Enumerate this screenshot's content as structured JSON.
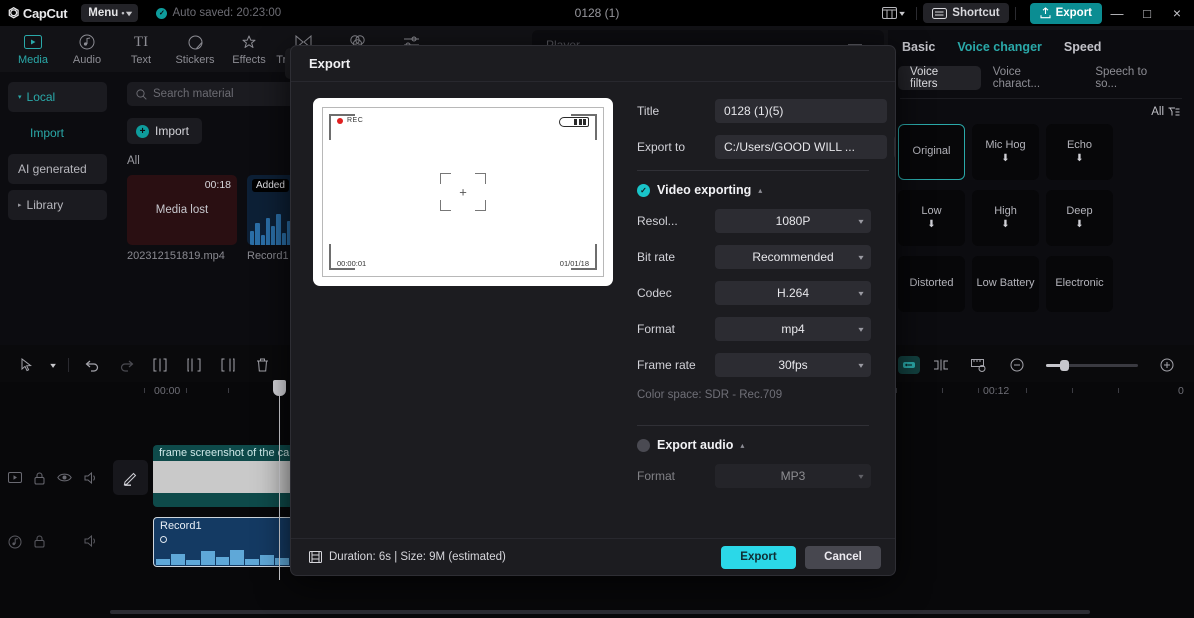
{
  "titlebar": {
    "logo": "CapCut",
    "menu_label": "Menu",
    "autosaved": "Auto saved: 20:23:00",
    "project_title": "0128 (1)",
    "shortcut_label": "Shortcut",
    "export_label": "Export",
    "minimize": "—",
    "maximize": "□",
    "close": "×"
  },
  "tabs": [
    {
      "label": "Media",
      "icon": "media-icon",
      "active": true
    },
    {
      "label": "Audio",
      "icon": "audio-icon",
      "active": false
    },
    {
      "label": "Text",
      "icon": "text-icon",
      "active": false
    },
    {
      "label": "Stickers",
      "icon": "stickers-icon",
      "active": false
    },
    {
      "label": "Effects",
      "icon": "effects-icon",
      "active": false
    },
    {
      "label": "Transitions",
      "icon": "transitions-icon",
      "active": false
    },
    {
      "label": "Filters",
      "icon": "filters-icon",
      "active": false
    },
    {
      "label": "Adjustment",
      "icon": "adjustment-icon",
      "active": false
    }
  ],
  "leftnav": [
    {
      "label": "Local",
      "selected": true
    },
    {
      "label": "Import",
      "selected": false
    },
    {
      "label": "AI generated",
      "selected": false
    },
    {
      "label": "Library",
      "selected": false
    }
  ],
  "media": {
    "search_placeholder": "Search material",
    "import_label": "Import",
    "all_label": "All",
    "items": [
      {
        "name": "202312151819.mp4",
        "duration": "00:18",
        "state": "Media lost",
        "badge": ""
      },
      {
        "name": "Record1",
        "duration": "",
        "state": "",
        "badge": "Added"
      }
    ]
  },
  "player": {
    "label": "Player"
  },
  "rightpanel": {
    "tabs": [
      {
        "label": "Basic",
        "active": false
      },
      {
        "label": "Voice changer",
        "active": true
      },
      {
        "label": "Speed",
        "active": false
      }
    ],
    "subtabs": [
      {
        "label": "Voice filters",
        "active": true
      },
      {
        "label": "Voice charact...",
        "active": false
      },
      {
        "label": "Speech to so...",
        "active": false
      }
    ],
    "filter_label": "All",
    "cards": [
      {
        "label": "Original",
        "selected": true,
        "downloadable": false
      },
      {
        "label": "Mic Hog",
        "selected": false,
        "downloadable": true
      },
      {
        "label": "Echo",
        "selected": false,
        "downloadable": true
      },
      {
        "label": "Low",
        "selected": false,
        "downloadable": true
      },
      {
        "label": "High",
        "selected": false,
        "downloadable": true
      },
      {
        "label": "Deep",
        "selected": false,
        "downloadable": true
      },
      {
        "label": "Distorted",
        "selected": false,
        "downloadable": false
      },
      {
        "label": "Low Battery",
        "selected": false,
        "downloadable": false
      },
      {
        "label": "Electronic",
        "selected": false,
        "downloadable": false
      }
    ]
  },
  "timeline": {
    "ruler_labels": [
      "00:00",
      "00:12",
      "0"
    ],
    "video_clip": "frame screenshot of the camera",
    "audio_clip": "Record1"
  },
  "dialog": {
    "heading": "Export",
    "title_label": "Title",
    "title_value": "0128 (1)(5)",
    "export_to_label": "Export to",
    "export_to_value": "C:/Users/GOOD WILL ...",
    "video_section": {
      "heading": "Video exporting",
      "enabled": true,
      "rows": [
        {
          "label": "Resol...",
          "value": "1080P"
        },
        {
          "label": "Bit rate",
          "value": "Recommended"
        },
        {
          "label": "Codec",
          "value": "H.264"
        },
        {
          "label": "Format",
          "value": "mp4"
        },
        {
          "label": "Frame rate",
          "value": "30fps"
        }
      ],
      "color_space": "Color space: SDR - Rec.709"
    },
    "audio_section": {
      "heading": "Export audio",
      "enabled": false,
      "rows": [
        {
          "label": "Format",
          "value": "MP3"
        }
      ]
    },
    "footer": {
      "duration_text": "Duration: 6s | Size: 9M (estimated)",
      "export_label": "Export",
      "cancel_label": "Cancel"
    },
    "preview": {
      "rec_label": "REC",
      "timecode": "00:00:01",
      "date": "01/01/18"
    }
  },
  "colors": {
    "accent_teal": "#2aa9a9",
    "export_cyan": "#2bd8e8",
    "dialog_bg": "#1c1c20"
  }
}
